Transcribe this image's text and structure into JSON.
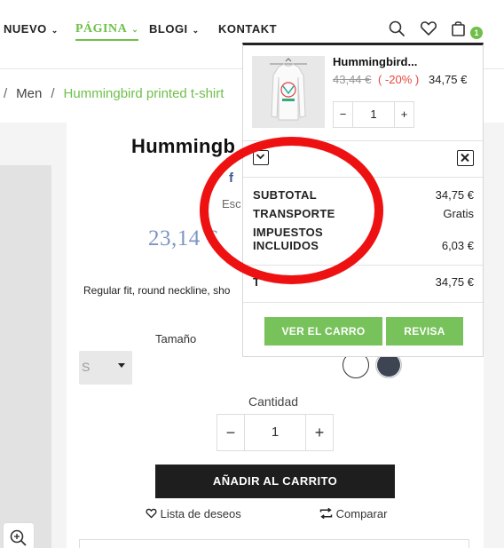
{
  "nav": {
    "items": [
      {
        "label": "NUEVO",
        "chevron": "⌄"
      },
      {
        "label": "PÁGINA",
        "chevron": "⌄"
      },
      {
        "label": "BLOGI",
        "chevron": "⌄"
      },
      {
        "label": "KONTAKT"
      }
    ],
    "cart_count": "1"
  },
  "breadcrumb": {
    "sep1": "/",
    "item": "Men",
    "sep2": "/",
    "current": "Hummingbird printed t-shirt"
  },
  "product": {
    "title": "Hummingb",
    "fb": "f",
    "small_text": "Esc",
    "price": "23,14 €",
    "description": "Regular fit, round neckline, sho",
    "size_label": "Tamaño",
    "size_value": "S",
    "qty_label": "Cantidad",
    "qty_value": "1",
    "add_to_cart": "AÑADIR AL CARRITO",
    "wishlist": "Lista de deseos",
    "compare": "Comparar"
  },
  "cart_dropdown": {
    "item_name": "Hummingbird...",
    "old_price": "43,44 €",
    "discount": "( -20% )",
    "new_price": "34,75 €",
    "qty": "1",
    "minus": "−",
    "plus": "+",
    "subtotal_label": "SUBTOTAL",
    "subtotal_value": "34,75 €",
    "shipping_label": "TRANSPORTE",
    "shipping_value": "Gratis",
    "taxes_label_1": "IMPUESTOS",
    "taxes_label_2": "INCLUIDOS",
    "taxes_value": "6,03 €",
    "total_label": "T",
    "total_value": "34,75 €",
    "view_cart": "VER EL CARRO",
    "checkout": "REVISA"
  },
  "colors": {
    "accent_green": "#6fbf4a",
    "button_green": "#77c25a",
    "discount_red": "#e8463c",
    "price_blue": "#7d95c4",
    "annotation_red": "#ee1111"
  }
}
